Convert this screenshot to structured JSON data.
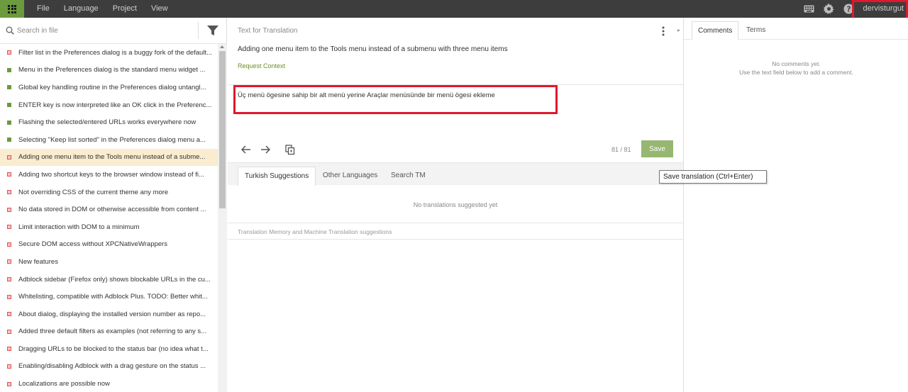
{
  "menu": {
    "items": [
      "File",
      "Language",
      "Project",
      "View"
    ]
  },
  "header": {
    "username": "dervisturgut"
  },
  "left_panel": {
    "search_placeholder": "Search in file",
    "items": [
      {
        "text": "Filter list in the Preferences dialog is a buggy fork of the default...",
        "status": "untranslated"
      },
      {
        "text": "Menu in the Preferences dialog is the standard menu widget ...",
        "status": "translated"
      },
      {
        "text": "Global key handling routine in the Preferences dialog untangl...",
        "status": "translated"
      },
      {
        "text": "ENTER key is now interpreted like an OK click in the Preferenc...",
        "status": "translated"
      },
      {
        "text": "Flashing the selected/entered URLs works everywhere now",
        "status": "translated"
      },
      {
        "text": "Selecting \"Keep list sorted\" in the Preferences dialog menu a...",
        "status": "translated"
      },
      {
        "text": "Adding one menu item to the Tools menu instead of a subme...",
        "status": "untranslated",
        "active": true
      },
      {
        "text": "Adding two shortcut keys to the browser window instead of fi...",
        "status": "untranslated"
      },
      {
        "text": "Not overriding CSS of the current theme any more",
        "status": "untranslated"
      },
      {
        "text": "No data stored in DOM or otherwise accessible from content ...",
        "status": "untranslated"
      },
      {
        "text": "Limit interaction with DOM to a minimum",
        "status": "untranslated"
      },
      {
        "text": "Secure DOM access without XPCNativeWrappers",
        "status": "untranslated"
      },
      {
        "text": "New features",
        "status": "untranslated"
      },
      {
        "text": "Adblock sidebar (Firefox only) shows blockable URLs in the cu...",
        "status": "untranslated"
      },
      {
        "text": "Whitelisting, compatible with Adblock Plus. TODO: Better whit...",
        "status": "untranslated"
      },
      {
        "text": "About dialog, displaying the installed version number as repo...",
        "status": "untranslated"
      },
      {
        "text": "Added three default filters as examples (not referring to any s...",
        "status": "untranslated"
      },
      {
        "text": "Dragging URLs to be blocked to the status bar (no idea what t...",
        "status": "untranslated"
      },
      {
        "text": "Enabling/disabling Adblock with a drag gesture on the status ...",
        "status": "untranslated"
      },
      {
        "text": "Localizations are possible now",
        "status": "untranslated"
      }
    ]
  },
  "editor": {
    "section_label": "Text for Translation",
    "source_text": "Adding one menu item to the Tools menu instead of a submenu with three menu items",
    "context_link": "Request Context",
    "translation_text": "Üç menü ögesine sahip bir alt menü yerine Araçlar menüsünde bir menü ögesi ekleme",
    "counter": "81 / 81",
    "save_label": "Save",
    "save_tooltip": "Save translation (Ctrl+Enter)",
    "tabs": [
      "Turkish Suggestions",
      "Other Languages",
      "Search TM"
    ],
    "no_suggestions": "No translations suggested yet",
    "tm_label": "Translation Memory and Machine Translation suggestions"
  },
  "right_panel": {
    "tabs": [
      "Comments",
      "Terms"
    ],
    "no_comments_line1": "No comments yet.",
    "no_comments_line2": "Use the text field below to add a comment."
  },
  "colors": {
    "accent_green": "#6c9a3e",
    "save_button": "#95b771",
    "highlight_red": "#e0182b",
    "active_row": "#f9eccf"
  }
}
